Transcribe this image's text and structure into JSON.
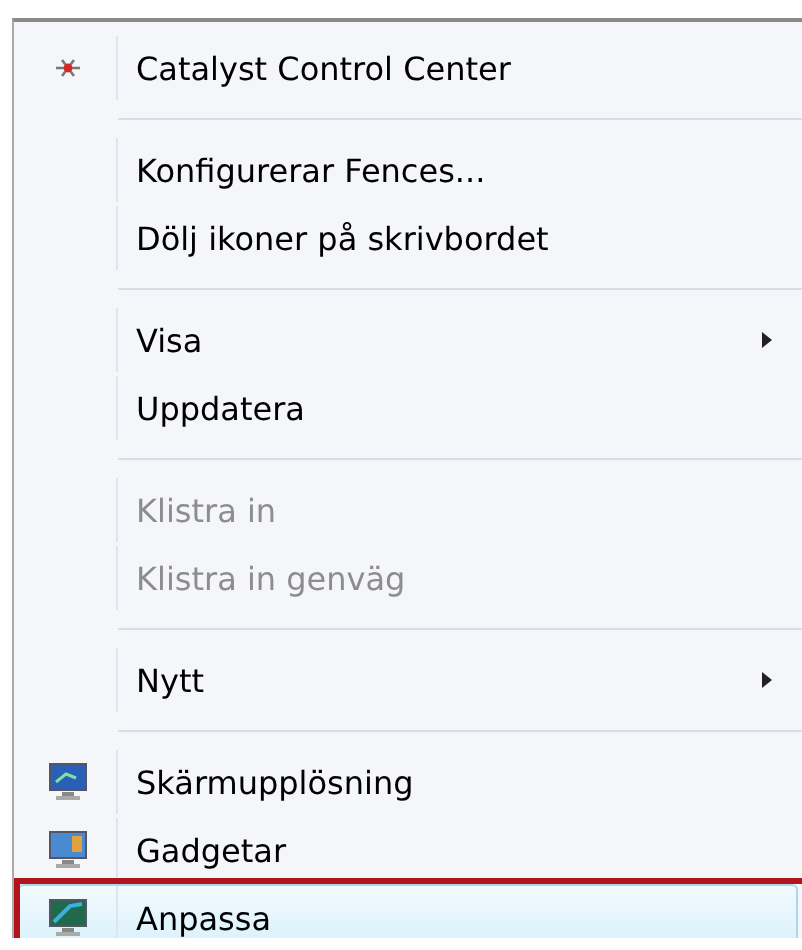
{
  "menu": {
    "groups": [
      {
        "items": [
          {
            "label": "Catalyst Control Center",
            "kind": "star",
            "disabled": false,
            "submenu": false,
            "selected": false,
            "marked": false
          }
        ]
      },
      {
        "items": [
          {
            "label": "Konfigurerar Fences...",
            "kind": "plain",
            "disabled": false,
            "submenu": false,
            "selected": false,
            "marked": false
          },
          {
            "label": "Dölj ikoner på skrivbordet",
            "kind": "plain",
            "disabled": false,
            "submenu": false,
            "selected": false,
            "marked": false
          }
        ]
      },
      {
        "items": [
          {
            "label": "Visa",
            "kind": "plain",
            "disabled": false,
            "submenu": true,
            "selected": false,
            "marked": false
          },
          {
            "label": "Uppdatera",
            "kind": "plain",
            "disabled": false,
            "submenu": false,
            "selected": false,
            "marked": false
          }
        ]
      },
      {
        "items": [
          {
            "label": "Klistra in",
            "kind": "plain",
            "disabled": true,
            "submenu": false,
            "selected": false,
            "marked": false
          },
          {
            "label": "Klistra in genväg",
            "kind": "plain",
            "disabled": true,
            "submenu": false,
            "selected": false,
            "marked": false
          }
        ]
      },
      {
        "items": [
          {
            "label": "Nytt",
            "kind": "plain",
            "disabled": false,
            "submenu": true,
            "selected": false,
            "marked": false
          }
        ]
      },
      {
        "items": [
          {
            "label": "Skärmupplösning",
            "kind": "monitor",
            "disabled": false,
            "submenu": false,
            "selected": false,
            "marked": false
          },
          {
            "label": "Gadgetar",
            "kind": "gadget",
            "disabled": false,
            "submenu": false,
            "selected": false,
            "marked": false
          },
          {
            "label": "Anpassa",
            "kind": "personalize",
            "disabled": false,
            "submenu": false,
            "selected": true,
            "marked": true
          }
        ]
      }
    ]
  }
}
